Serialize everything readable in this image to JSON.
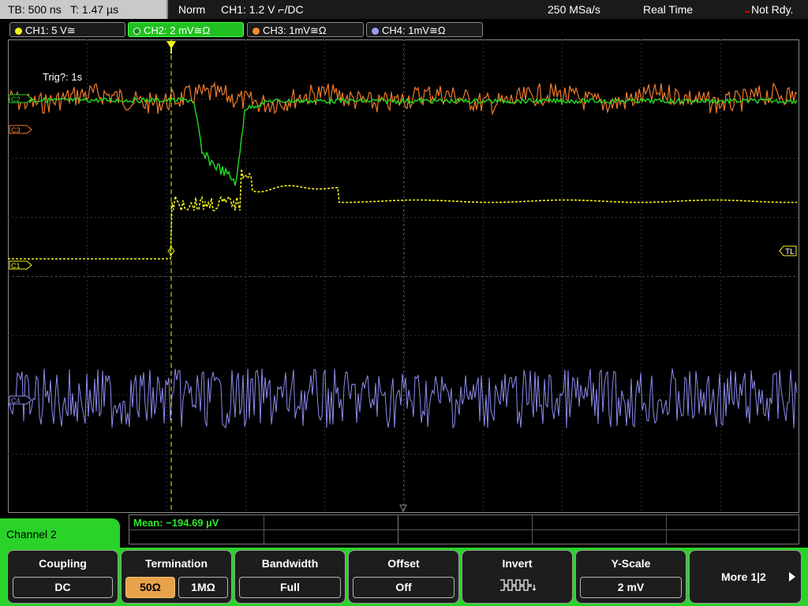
{
  "status_bar": {
    "timebase": "TB: 500 ns",
    "trigger_time": "T: 1.47 µs",
    "mode": "Norm",
    "trigger_setting": "CH1: 1.2 V ⌐/DC",
    "sample_rate": "250 MSa/s",
    "acq_mode": "Real Time",
    "state": "Not Rdy."
  },
  "channel_tabs": [
    {
      "label": "CH1: 5 V≅",
      "color": "#f2f21a"
    },
    {
      "label": "CH2: 2 mV≅Ω",
      "color": "#2ad22a"
    },
    {
      "label": "CH3: 1mV≅Ω",
      "color": "#ff8a2a"
    },
    {
      "label": "CH4: 1mV≅Ω",
      "color": "#9a9af0"
    }
  ],
  "waveform": {
    "trigger_note": "Trig?: 1s",
    "markers": {
      "c1": "C1",
      "c2": "C2",
      "c3": "C3",
      "c4": "C4",
      "trigger_level": "TL"
    },
    "colors": {
      "ch1": "#f2f21a",
      "ch2": "#22dd22",
      "ch3": "#f07a2a",
      "ch4": "#8c8cf0",
      "grid": "#2a2a2a",
      "frame": "#8a8a8a"
    }
  },
  "measurement": {
    "mean": "Mean: −194.69 µV"
  },
  "menu": {
    "title": "Channel 2",
    "coupling": {
      "label": "Coupling",
      "value": "DC"
    },
    "termination": {
      "label": "Termination",
      "options": [
        "50Ω",
        "1MΩ"
      ],
      "selected": "50Ω"
    },
    "bandwidth": {
      "label": "Bandwidth",
      "value": "Full"
    },
    "offset": {
      "label": "Offset",
      "value": "Off"
    },
    "invert": {
      "label": "Invert"
    },
    "yscale": {
      "label": "Y-Scale",
      "value": "2 mV"
    },
    "more": {
      "label": "More 1|2"
    }
  }
}
